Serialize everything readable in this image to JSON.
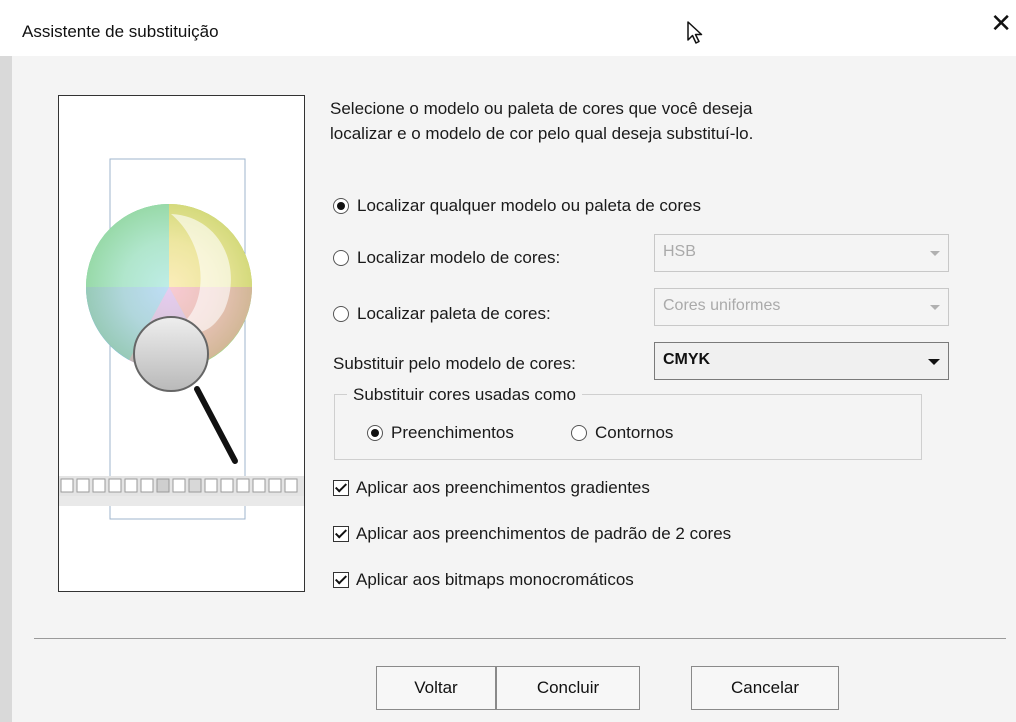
{
  "window": {
    "title": "Assistente de substituição"
  },
  "intro": {
    "line1": "Selecione o modelo ou paleta de cores que você deseja",
    "line2": "localizar e o modelo de cor pelo qual deseja substituí-lo."
  },
  "options": {
    "find_any": "Localizar qualquer modelo ou paleta de cores",
    "find_model": "Localizar modelo de cores:",
    "find_palette": "Localizar paleta de cores:",
    "replace_with": "Substituir pelo modelo de cores:"
  },
  "selects": {
    "model": "HSB",
    "palette": "Cores uniformes",
    "replace_model": "CMYK"
  },
  "group": {
    "title": "Substituir cores usadas como",
    "fills": "Preenchimentos",
    "outlines": "Contornos"
  },
  "checks": {
    "gradients": "Aplicar aos preenchimentos gradientes",
    "two_color": "Aplicar aos preenchimentos de padrão de 2 cores",
    "mono_bitmaps": "Aplicar aos bitmaps monocromáticos"
  },
  "buttons": {
    "back": "Voltar",
    "finish": "Concluir",
    "cancel": "Cancelar"
  },
  "state": {
    "selected_find": "find_any",
    "selected_apply": "fills",
    "gradients_checked": true,
    "two_color_checked": true,
    "mono_bitmaps_checked": true
  },
  "icons": [
    "close-icon",
    "cursor-icon",
    "dropdown-arrow-icon",
    "magnifier-icon",
    "color-wheel-icon"
  ]
}
